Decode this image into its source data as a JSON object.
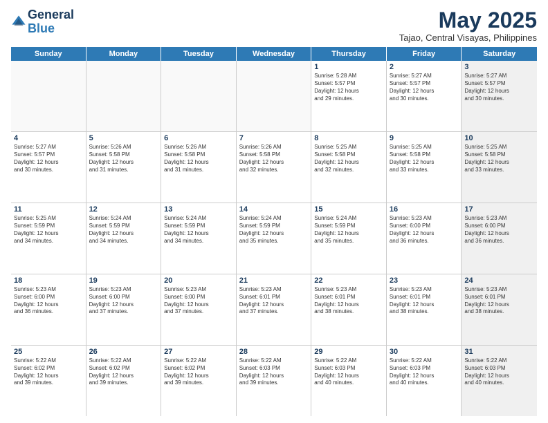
{
  "header": {
    "logo_line1": "General",
    "logo_line2": "Blue",
    "month_title": "May 2025",
    "location": "Tajao, Central Visayas, Philippines"
  },
  "days_of_week": [
    "Sunday",
    "Monday",
    "Tuesday",
    "Wednesday",
    "Thursday",
    "Friday",
    "Saturday"
  ],
  "weeks": [
    [
      {
        "day": "",
        "text": "",
        "empty": true
      },
      {
        "day": "",
        "text": "",
        "empty": true
      },
      {
        "day": "",
        "text": "",
        "empty": true
      },
      {
        "day": "",
        "text": "",
        "empty": true
      },
      {
        "day": "1",
        "text": "Sunrise: 5:28 AM\nSunset: 5:57 PM\nDaylight: 12 hours\nand 29 minutes.",
        "empty": false,
        "shaded": false
      },
      {
        "day": "2",
        "text": "Sunrise: 5:27 AM\nSunset: 5:57 PM\nDaylight: 12 hours\nand 30 minutes.",
        "empty": false,
        "shaded": false
      },
      {
        "day": "3",
        "text": "Sunrise: 5:27 AM\nSunset: 5:57 PM\nDaylight: 12 hours\nand 30 minutes.",
        "empty": false,
        "shaded": true
      }
    ],
    [
      {
        "day": "4",
        "text": "Sunrise: 5:27 AM\nSunset: 5:57 PM\nDaylight: 12 hours\nand 30 minutes.",
        "empty": false,
        "shaded": false
      },
      {
        "day": "5",
        "text": "Sunrise: 5:26 AM\nSunset: 5:58 PM\nDaylight: 12 hours\nand 31 minutes.",
        "empty": false,
        "shaded": false
      },
      {
        "day": "6",
        "text": "Sunrise: 5:26 AM\nSunset: 5:58 PM\nDaylight: 12 hours\nand 31 minutes.",
        "empty": false,
        "shaded": false
      },
      {
        "day": "7",
        "text": "Sunrise: 5:26 AM\nSunset: 5:58 PM\nDaylight: 12 hours\nand 32 minutes.",
        "empty": false,
        "shaded": false
      },
      {
        "day": "8",
        "text": "Sunrise: 5:25 AM\nSunset: 5:58 PM\nDaylight: 12 hours\nand 32 minutes.",
        "empty": false,
        "shaded": false
      },
      {
        "day": "9",
        "text": "Sunrise: 5:25 AM\nSunset: 5:58 PM\nDaylight: 12 hours\nand 33 minutes.",
        "empty": false,
        "shaded": false
      },
      {
        "day": "10",
        "text": "Sunrise: 5:25 AM\nSunset: 5:58 PM\nDaylight: 12 hours\nand 33 minutes.",
        "empty": false,
        "shaded": true
      }
    ],
    [
      {
        "day": "11",
        "text": "Sunrise: 5:25 AM\nSunset: 5:59 PM\nDaylight: 12 hours\nand 34 minutes.",
        "empty": false,
        "shaded": false
      },
      {
        "day": "12",
        "text": "Sunrise: 5:24 AM\nSunset: 5:59 PM\nDaylight: 12 hours\nand 34 minutes.",
        "empty": false,
        "shaded": false
      },
      {
        "day": "13",
        "text": "Sunrise: 5:24 AM\nSunset: 5:59 PM\nDaylight: 12 hours\nand 34 minutes.",
        "empty": false,
        "shaded": false
      },
      {
        "day": "14",
        "text": "Sunrise: 5:24 AM\nSunset: 5:59 PM\nDaylight: 12 hours\nand 35 minutes.",
        "empty": false,
        "shaded": false
      },
      {
        "day": "15",
        "text": "Sunrise: 5:24 AM\nSunset: 5:59 PM\nDaylight: 12 hours\nand 35 minutes.",
        "empty": false,
        "shaded": false
      },
      {
        "day": "16",
        "text": "Sunrise: 5:23 AM\nSunset: 6:00 PM\nDaylight: 12 hours\nand 36 minutes.",
        "empty": false,
        "shaded": false
      },
      {
        "day": "17",
        "text": "Sunrise: 5:23 AM\nSunset: 6:00 PM\nDaylight: 12 hours\nand 36 minutes.",
        "empty": false,
        "shaded": true
      }
    ],
    [
      {
        "day": "18",
        "text": "Sunrise: 5:23 AM\nSunset: 6:00 PM\nDaylight: 12 hours\nand 36 minutes.",
        "empty": false,
        "shaded": false
      },
      {
        "day": "19",
        "text": "Sunrise: 5:23 AM\nSunset: 6:00 PM\nDaylight: 12 hours\nand 37 minutes.",
        "empty": false,
        "shaded": false
      },
      {
        "day": "20",
        "text": "Sunrise: 5:23 AM\nSunset: 6:00 PM\nDaylight: 12 hours\nand 37 minutes.",
        "empty": false,
        "shaded": false
      },
      {
        "day": "21",
        "text": "Sunrise: 5:23 AM\nSunset: 6:01 PM\nDaylight: 12 hours\nand 37 minutes.",
        "empty": false,
        "shaded": false
      },
      {
        "day": "22",
        "text": "Sunrise: 5:23 AM\nSunset: 6:01 PM\nDaylight: 12 hours\nand 38 minutes.",
        "empty": false,
        "shaded": false
      },
      {
        "day": "23",
        "text": "Sunrise: 5:23 AM\nSunset: 6:01 PM\nDaylight: 12 hours\nand 38 minutes.",
        "empty": false,
        "shaded": false
      },
      {
        "day": "24",
        "text": "Sunrise: 5:23 AM\nSunset: 6:01 PM\nDaylight: 12 hours\nand 38 minutes.",
        "empty": false,
        "shaded": true
      }
    ],
    [
      {
        "day": "25",
        "text": "Sunrise: 5:22 AM\nSunset: 6:02 PM\nDaylight: 12 hours\nand 39 minutes.",
        "empty": false,
        "shaded": false
      },
      {
        "day": "26",
        "text": "Sunrise: 5:22 AM\nSunset: 6:02 PM\nDaylight: 12 hours\nand 39 minutes.",
        "empty": false,
        "shaded": false
      },
      {
        "day": "27",
        "text": "Sunrise: 5:22 AM\nSunset: 6:02 PM\nDaylight: 12 hours\nand 39 minutes.",
        "empty": false,
        "shaded": false
      },
      {
        "day": "28",
        "text": "Sunrise: 5:22 AM\nSunset: 6:03 PM\nDaylight: 12 hours\nand 39 minutes.",
        "empty": false,
        "shaded": false
      },
      {
        "day": "29",
        "text": "Sunrise: 5:22 AM\nSunset: 6:03 PM\nDaylight: 12 hours\nand 40 minutes.",
        "empty": false,
        "shaded": false
      },
      {
        "day": "30",
        "text": "Sunrise: 5:22 AM\nSunset: 6:03 PM\nDaylight: 12 hours\nand 40 minutes.",
        "empty": false,
        "shaded": false
      },
      {
        "day": "31",
        "text": "Sunrise: 5:22 AM\nSunset: 6:03 PM\nDaylight: 12 hours\nand 40 minutes.",
        "empty": false,
        "shaded": true
      }
    ]
  ]
}
